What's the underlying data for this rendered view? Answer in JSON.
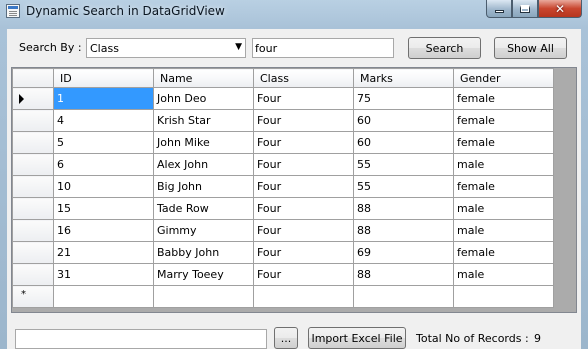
{
  "window": {
    "title": "Dynamic Search in DataGridView"
  },
  "search": {
    "label": "Search By :",
    "field_selected": "Class",
    "query_value": "four",
    "search_button": "Search",
    "show_all_button": "Show All"
  },
  "grid": {
    "columns": [
      "ID",
      "Name",
      "Class",
      "Marks",
      "Gender"
    ],
    "rows": [
      [
        "1",
        "John Deo",
        "Four",
        "75",
        "female"
      ],
      [
        "4",
        "Krish Star",
        "Four",
        "60",
        "female"
      ],
      [
        "5",
        "John Mike",
        "Four",
        "60",
        "female"
      ],
      [
        "6",
        "Alex John",
        "Four",
        "55",
        "male"
      ],
      [
        "10",
        "Big John",
        "Four",
        "55",
        "female"
      ],
      [
        "15",
        "Tade Row",
        "Four",
        "88",
        "male"
      ],
      [
        "16",
        "Gimmy",
        "Four",
        "88",
        "male"
      ],
      [
        "21",
        "Babby John",
        "Four",
        "69",
        "female"
      ],
      [
        "31",
        "Marry Toeey",
        "Four",
        "88",
        "male"
      ]
    ],
    "new_row_marker": "*"
  },
  "footer": {
    "path_value": "",
    "browse_button": "...",
    "import_button": "Import Excel File",
    "total_label": "Total No of Records :",
    "total_count": "9"
  },
  "colors": {
    "selection": "#3399ff",
    "grid_background": "#ababab"
  },
  "icons": [
    "app-icon",
    "minimize-icon",
    "maximize-icon",
    "close-icon",
    "dropdown-arrow-icon",
    "current-row-icon"
  ]
}
